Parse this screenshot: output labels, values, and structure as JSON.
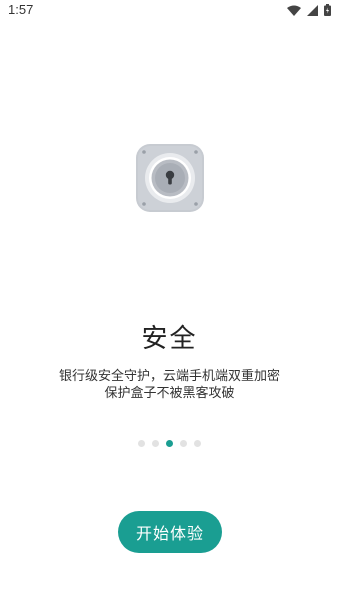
{
  "status_bar": {
    "time": "1:57",
    "icons": [
      "wifi-icon",
      "cell-signal-icon",
      "battery-icon"
    ]
  },
  "onboarding": {
    "illustration": "lock-icon",
    "title": "安全",
    "description_lines": [
      "银行级安全守护，云端手机端双重加密",
      "保护盒子不被黑客攻破"
    ],
    "page_count": 5,
    "active_page": 3
  },
  "actions": {
    "start_label": "开始体验"
  },
  "colors": {
    "accent": "#1a9e92",
    "dot_inactive": "#e2e2e2",
    "lock_body": "#c7cbd1"
  }
}
